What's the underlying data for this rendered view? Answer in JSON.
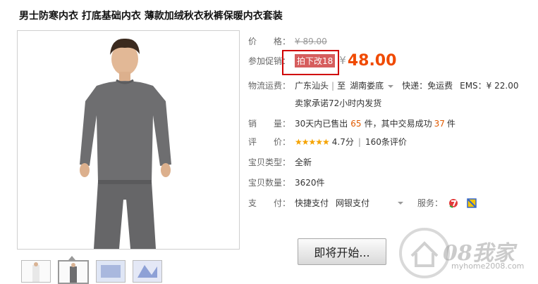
{
  "product": {
    "title": "男士防寒内衣 打底基础内衣 薄款加绒秋衣秋裤保暖内衣套装"
  },
  "price": {
    "label": "价　　格：",
    "original": "¥ 89.00"
  },
  "promo": {
    "label": "参加促销：",
    "badge": "拍下改18",
    "yen": "¥",
    "price": "48.00"
  },
  "shipping": {
    "label": "物流运费：",
    "from": "广东汕头",
    "to_prefix": "至",
    "to": "湖南娄底",
    "express": "快递：免运费",
    "ems": "EMS：¥ 22.00",
    "promise": "卖家承诺72小时内发货"
  },
  "sales": {
    "label": "销　　量：",
    "prefix": "30天内已售出",
    "sold": "65",
    "unit1": "件，其中交易成功",
    "success": "37",
    "unit2": "件"
  },
  "rating": {
    "label": "评　　价：",
    "stars": "★★★★★",
    "score": "4.7分",
    "count": "160条评价"
  },
  "type": {
    "label": "宝贝类型：",
    "value": "全新"
  },
  "quantity": {
    "label": "宝贝数量：",
    "value": "3620件"
  },
  "payment": {
    "label": "支　　付：",
    "quick": "快捷支付",
    "bank": "网银支付",
    "service_label": "服务："
  },
  "button": {
    "label": "即将开始..."
  },
  "watermark": {
    "brand": "08我家",
    "url": "myhome2008.com"
  },
  "colors": {
    "accent": "#f04a00",
    "highlight_box": "#d00000",
    "badge_bg": "#d65d5d"
  }
}
